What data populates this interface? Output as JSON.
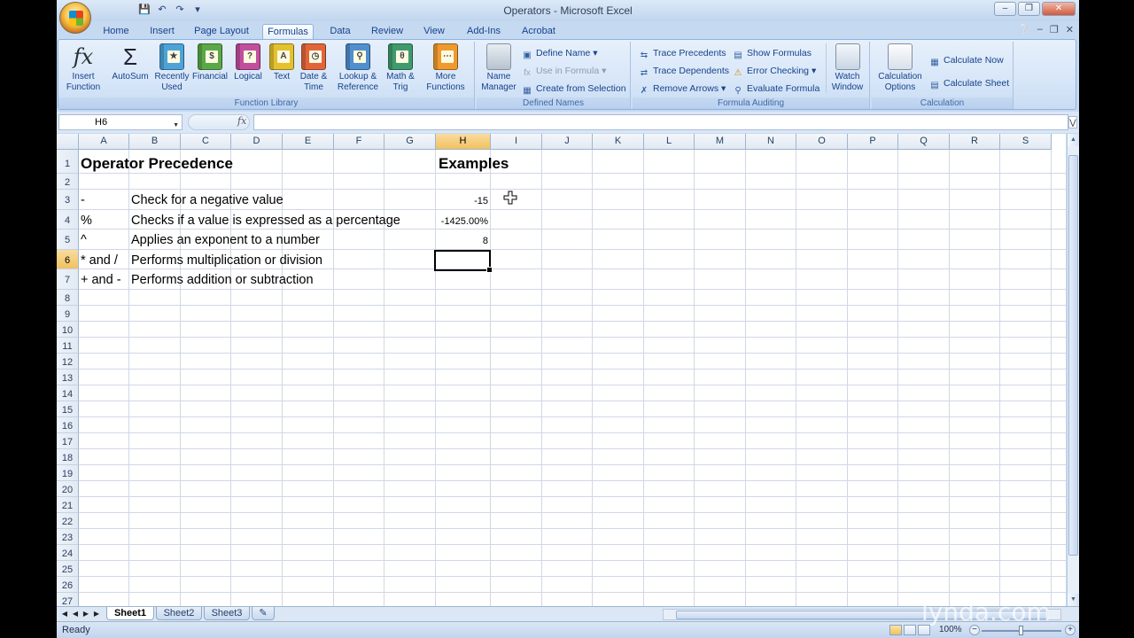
{
  "window": {
    "title": "Operators - Microsoft Excel"
  },
  "qat": {
    "icons": [
      "save-icon",
      "undo-icon",
      "redo-icon",
      "customize-icon"
    ]
  },
  "tabs": [
    "Home",
    "Insert",
    "Page Layout",
    "Formulas",
    "Data",
    "Review",
    "View",
    "Add-Ins",
    "Acrobat"
  ],
  "active_tab": "Formulas",
  "ribbon": {
    "function_library": {
      "label": "Function Library",
      "insert_function": "Insert Function",
      "autosum": "AutoSum",
      "recently_used": "Recently Used",
      "financial": "Financial",
      "logical": "Logical",
      "text": "Text",
      "date_time": "Date & Time",
      "lookup_reference": "Lookup & Reference",
      "math_trig": "Math & Trig",
      "more_functions": "More Functions"
    },
    "defined_names": {
      "label": "Defined Names",
      "name_manager": "Name Manager",
      "define_name": "Define Name",
      "use_in_formula": "Use in Formula",
      "create_from_selection": "Create from Selection"
    },
    "formula_auditing": {
      "label": "Formula Auditing",
      "trace_precedents": "Trace Precedents",
      "trace_dependents": "Trace Dependents",
      "remove_arrows": "Remove Arrows",
      "show_formulas": "Show Formulas",
      "error_checking": "Error Checking",
      "evaluate_formula": "Evaluate Formula",
      "watch_window": "Watch Window"
    },
    "calculation": {
      "label": "Calculation",
      "calculation_options": "Calculation Options",
      "calculate_now": "Calculate Now",
      "calculate_sheet": "Calculate Sheet"
    }
  },
  "formula_bar": {
    "name_box": "H6",
    "fx": "fx",
    "formula": ""
  },
  "columns": [
    "A",
    "B",
    "C",
    "D",
    "E",
    "F",
    "G",
    "H",
    "I",
    "J",
    "K",
    "L",
    "M",
    "N",
    "O",
    "P",
    "Q",
    "R",
    "S"
  ],
  "selected_column": "H",
  "rows": [
    "1",
    "2",
    "3",
    "4",
    "5",
    "6",
    "7",
    "8",
    "9",
    "10",
    "11",
    "12",
    "13",
    "14",
    "15",
    "16",
    "17",
    "18",
    "19",
    "20",
    "21",
    "22",
    "23",
    "24",
    "25",
    "26",
    "27"
  ],
  "selected_row": "6",
  "cells": {
    "A1": "Operator Precedence",
    "H1": "Examples",
    "A3": "-",
    "B3": "Check for a negative value",
    "H3": "-15",
    "A4": "%",
    "B4": "Checks if a value is expressed as a percentage",
    "H4": "-1425.00%",
    "A5": "^",
    "B5": "Applies an exponent to a number",
    "H5": "8",
    "A6": "* and /",
    "B6": "Performs multiplication or division",
    "A7": "+ and -",
    "B7": "Performs addition or subtraction"
  },
  "selected_cell": "H6",
  "sheets": [
    "Sheet1",
    "Sheet2",
    "Sheet3"
  ],
  "active_sheet": "Sheet1",
  "status": {
    "text": "Ready",
    "zoom": "100%"
  },
  "watermark": "lynda.com"
}
